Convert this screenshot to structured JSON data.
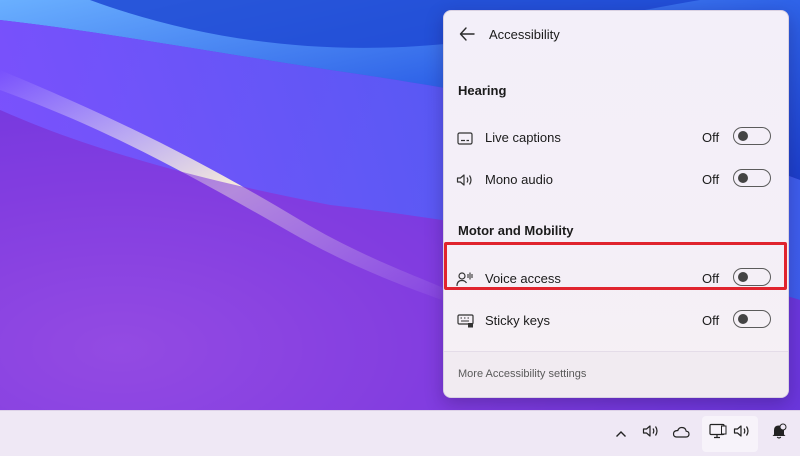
{
  "panel": {
    "title": "Accessibility",
    "back_icon": "arrow-left-icon",
    "sections": [
      {
        "heading": "Hearing",
        "items": [
          {
            "label": "Live captions",
            "state": "Off",
            "icon": "captions-icon",
            "enabled": false
          },
          {
            "label": "Mono audio",
            "state": "Off",
            "icon": "speaker-icon",
            "enabled": false
          }
        ]
      },
      {
        "heading": "Motor and Mobility",
        "items": [
          {
            "label": "Voice access",
            "state": "Off",
            "icon": "voice-access-icon",
            "enabled": false,
            "highlighted": true
          },
          {
            "label": "Sticky keys",
            "state": "Off",
            "icon": "keyboard-icon",
            "enabled": false
          }
        ]
      }
    ],
    "footer_link": "More Accessibility settings",
    "highlight_color": "#e0242e"
  },
  "taskbar": {
    "tray_icons": [
      "chevron-up-icon",
      "speaker-icon",
      "cloud-icon",
      "network-icon",
      "volume-icon",
      "notification-bell-icon"
    ]
  }
}
